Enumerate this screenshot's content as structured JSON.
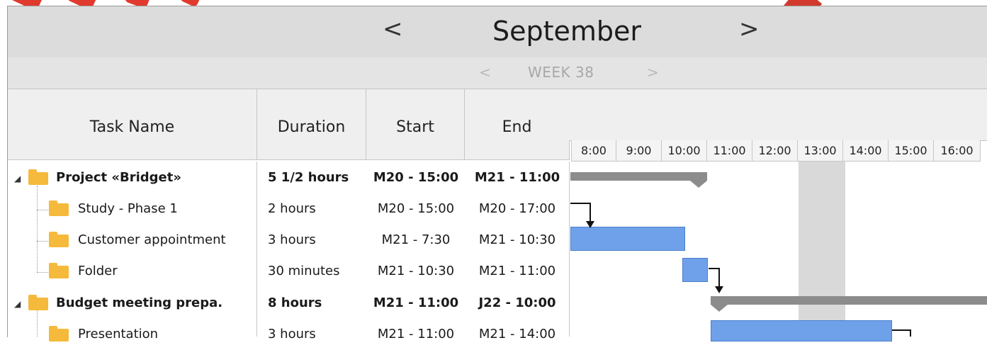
{
  "header": {
    "month": "September",
    "prev_month_icon": "<",
    "next_month_icon": ">",
    "week": "WEEK 38",
    "prev_week_icon": "<",
    "next_week_icon": ">"
  },
  "columns": {
    "task_name": "Task Name",
    "duration": "Duration",
    "start": "Start",
    "end": "End"
  },
  "hours": [
    "8:00",
    "9:00",
    "10:00",
    "11:00",
    "12:00",
    "13:00",
    "14:00",
    "15:00",
    "16:00"
  ],
  "tasks": [
    {
      "name": "Project «Bridget»",
      "duration": "5 1/2 hours",
      "start": "M20 - 15:00",
      "end": "M21 - 11:00",
      "summary": true
    },
    {
      "name": "Study - Phase 1",
      "duration": "2 hours",
      "start": "M20 - 15:00",
      "end": "M20 - 17:00",
      "summary": false
    },
    {
      "name": "Customer appointment",
      "duration": "3 hours",
      "start": "M21 - 7:30",
      "end": "M21 - 10:30",
      "summary": false
    },
    {
      "name": "Folder",
      "duration": "30 minutes",
      "start": "M21 - 10:30",
      "end": "M21 - 11:00",
      "summary": false
    },
    {
      "name": "Budget meeting prepa.",
      "duration": "8 hours",
      "start": "M21 - 11:00",
      "end": "J22 - 10:00",
      "summary": true
    },
    {
      "name": "Presentation",
      "duration": "3 hours",
      "start": "M21 - 11:00",
      "end": "M21 - 14:00",
      "summary": false
    }
  ],
  "colors": {
    "task_bar": "#6fa1ea",
    "summary_bar": "#8c8c8c",
    "folder": "#f5b93b",
    "current_hour_highlight": "#d9d9d9"
  }
}
